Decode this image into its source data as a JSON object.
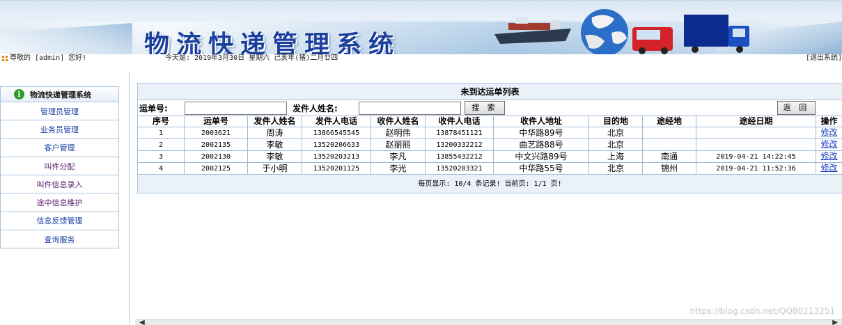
{
  "header": {
    "title": "物流快递管理系统"
  },
  "infobar": {
    "greeting": "尊敬的 [admin] 您好!",
    "today": "今天是: 2019年3月30日 星期六 己亥年(猪)二月廿四",
    "logout": "[退出系统]"
  },
  "sidebar": {
    "title": "物流快递管理系统",
    "items": [
      {
        "label": "管理员管理"
      },
      {
        "label": "业务员管理"
      },
      {
        "label": "客户管理"
      },
      {
        "label": "叫件分配"
      },
      {
        "label": "叫件信息录入"
      },
      {
        "label": "途中信息维护"
      },
      {
        "label": "信息反馈管理"
      },
      {
        "label": "查询服务"
      }
    ]
  },
  "main": {
    "caption": "未到达运单列表",
    "search": {
      "waybill_label": "运单号:",
      "waybill_value": "",
      "sender_label": "发件人姓名:",
      "sender_value": "",
      "search_button": "搜 索",
      "back_button": "返 回"
    },
    "columns": [
      "序号",
      "运单号",
      "发件人姓名",
      "发件人电话",
      "收件人姓名",
      "收件人电话",
      "收件人地址",
      "目的地",
      "途经地",
      "途经日期",
      "操作"
    ],
    "rows": [
      {
        "no": "1",
        "waybill": "2003621",
        "sender": "周涛",
        "sender_phone": "13866545545",
        "receiver": "赵明伟",
        "receiver_phone": "13878451121",
        "address": "中华路89号",
        "dest": "北京",
        "via": "",
        "via_date": "",
        "action": "修改"
      },
      {
        "no": "2",
        "waybill": "2002135",
        "sender": "李敏",
        "sender_phone": "13520206633",
        "receiver": "赵丽丽",
        "receiver_phone": "13200332212",
        "address": "曲艺路88号",
        "dest": "北京",
        "via": "",
        "via_date": "",
        "action": "修改"
      },
      {
        "no": "3",
        "waybill": "2002130",
        "sender": "李敏",
        "sender_phone": "13520203213",
        "receiver": "李凡",
        "receiver_phone": "13855432212",
        "address": "中文兴路89号",
        "dest": "上海",
        "via": "南通",
        "via_date": "2019-04-21 14:22:45",
        "action": "修改"
      },
      {
        "no": "4",
        "waybill": "2002125",
        "sender": "于小明",
        "sender_phone": "13520201125",
        "receiver": "李光",
        "receiver_phone": "13520203321",
        "address": "中华路55号",
        "dest": "北京",
        "via": "锦州",
        "via_date": "2019-04-21 11:52:36",
        "action": "修改"
      }
    ],
    "pager": "每页显示: 10/4 条记录! 当前页: 1/1 页!"
  },
  "watermark": "https://blog.csdn.net/QQ80213251"
}
